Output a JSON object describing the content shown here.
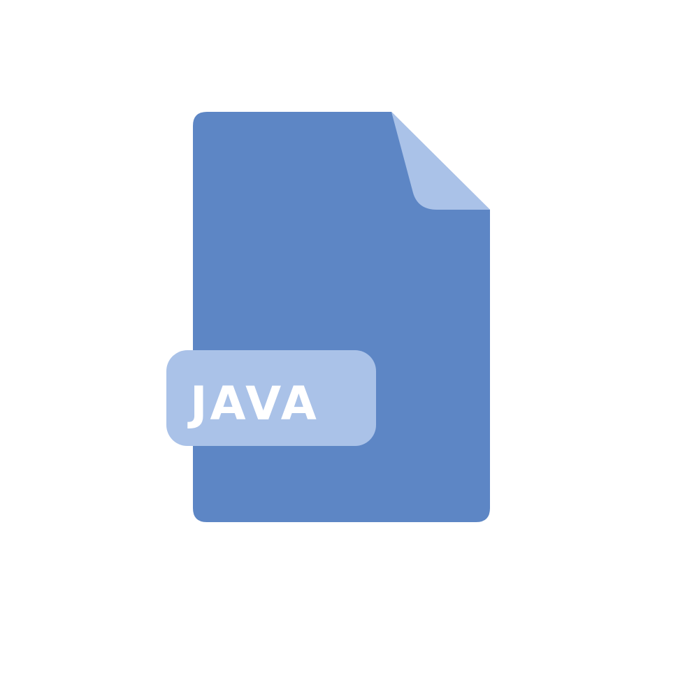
{
  "icon": {
    "name": "file-java-icon",
    "extension_label": "JAVA",
    "colors": {
      "background": "#ffffff",
      "page": "#5d86c5",
      "fold": "#aac2e8",
      "tag": "#aac2e8",
      "label_text": "#ffffff"
    }
  }
}
